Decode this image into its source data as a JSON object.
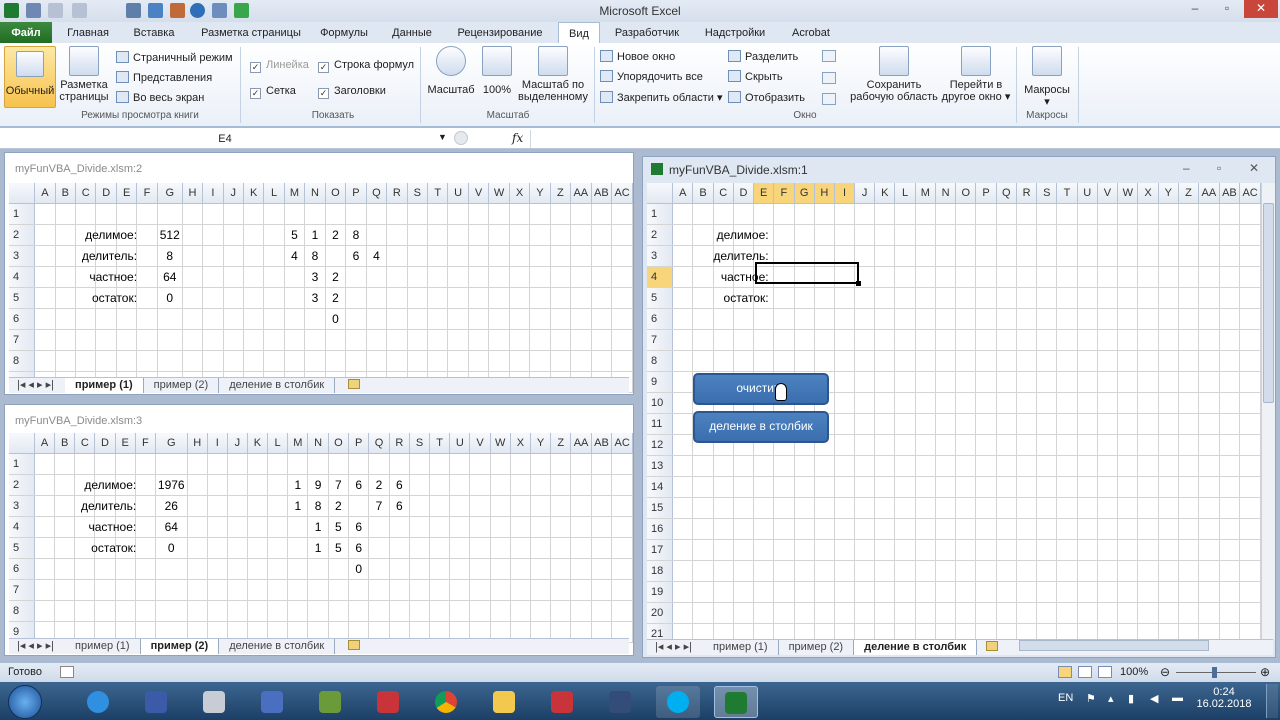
{
  "app": {
    "title": "Microsoft Excel"
  },
  "ribbon": {
    "tabs": [
      "Главная",
      "Вставка",
      "Разметка страницы",
      "Формулы",
      "Данные",
      "Рецензирование",
      "Вид",
      "Разработчик",
      "Надстройки",
      "Acrobat"
    ],
    "file_tab": "Файл",
    "active_tab": "Вид",
    "views": {
      "normal": "Обычный",
      "page_layout_1": "Разметка",
      "page_layout_2": "страницы",
      "page_break": "Страничный режим",
      "custom": "Представления",
      "fullscreen": "Во весь экран",
      "group": "Режимы просмотра книги"
    },
    "show": {
      "ruler": "Линейка",
      "formula_bar": "Строка формул",
      "gridlines": "Сетка",
      "headings": "Заголовки",
      "group": "Показать"
    },
    "zoom": {
      "zoom": "Масштаб",
      "hundred": "100%",
      "selection_1": "Масштаб по",
      "selection_2": "выделенному",
      "group": "Масштаб"
    },
    "window": {
      "new_window": "Новое окно",
      "arrange": "Упорядочить все",
      "freeze": "Закрепить области",
      "split": "Разделить",
      "hide": "Скрыть",
      "unhide": "Отобразить",
      "save_ws_1": "Сохранить",
      "save_ws_2": "рабочую область",
      "switch_1": "Перейти в",
      "switch_2": "другое окно",
      "group": "Окно"
    },
    "macros": {
      "label": "Макросы",
      "group": "Макросы"
    }
  },
  "formula_bar": {
    "name_box": "E4",
    "fx": "fx",
    "value": ""
  },
  "windows": [
    {
      "title": "myFunVBA_Divide.xlsm:2",
      "tabs": [
        "пример (1)",
        "пример (2)",
        "деление в столбик"
      ],
      "active_tab": 0
    },
    {
      "title": "myFunVBA_Divide.xlsm:3",
      "tabs": [
        "пример (1)",
        "пример (2)",
        "деление в столбик"
      ],
      "active_tab": 1
    },
    {
      "title": "myFunVBA_Divide.xlsm:1",
      "tabs": [
        "пример (1)",
        "пример (2)",
        "деление в столбик"
      ],
      "active_tab": 2,
      "buttons": {
        "clear": "очистить",
        "divide": "деление в столбик"
      }
    }
  ],
  "columns_left": [
    "A",
    "B",
    "C",
    "D",
    "E",
    "F",
    "G",
    "H",
    "I",
    "J",
    "K",
    "L",
    "M",
    "N",
    "O",
    "P",
    "Q",
    "R",
    "S",
    "T",
    "U",
    "V",
    "W",
    "X",
    "Y",
    "Z",
    "AA",
    "AB",
    "AC"
  ],
  "columns_right": [
    "A",
    "B",
    "C",
    "D",
    "E",
    "F",
    "G",
    "H",
    "I",
    "J",
    "K",
    "L",
    "M",
    "N",
    "O",
    "P",
    "Q",
    "R",
    "S",
    "T",
    "U",
    "V",
    "W",
    "X",
    "Y",
    "Z",
    "AA",
    "AB",
    "AC"
  ],
  "sheet1": {
    "labels": [
      "делимое:",
      "делитель:",
      "частное:",
      "остаток:"
    ],
    "values": [
      "512",
      "8",
      "64",
      "0"
    ]
  },
  "sheet2": {
    "labels": [
      "делимое:",
      "делитель:",
      "частное:",
      "остаток:"
    ],
    "values": [
      "1976",
      "26",
      "64",
      "0"
    ]
  },
  "sheet3": {
    "labels": [
      "делимое:",
      "делитель:",
      "частное:",
      "остаток:"
    ]
  },
  "status": {
    "ready": "Готово",
    "zoom": "100%"
  },
  "taskbar": {
    "lang": "EN",
    "time": "0:24",
    "date": "16.02.2018"
  }
}
